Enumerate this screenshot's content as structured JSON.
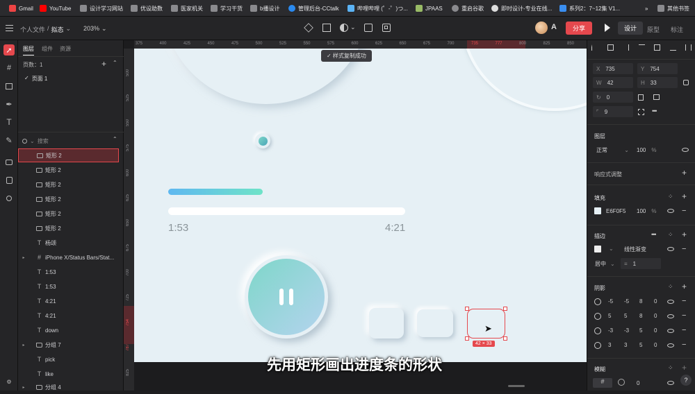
{
  "bookmarks": [
    {
      "label": "Gmail"
    },
    {
      "label": "YouTube"
    },
    {
      "label": "设计学习网站"
    },
    {
      "label": "优设助数"
    },
    {
      "label": "医家机关"
    },
    {
      "label": "学习干货"
    },
    {
      "label": "b播设计"
    },
    {
      "label": "管理后台-CCtalk"
    },
    {
      "label": "哔哩哔哩 (゜-゜)つ..."
    },
    {
      "label": "JPAAS"
    },
    {
      "label": "重启谷歌"
    },
    {
      "label": "即时设计-专业在线..."
    },
    {
      "label": "系列2：7~12集 V1..."
    },
    {
      "label": "»"
    },
    {
      "label": "其他书签"
    }
  ],
  "toolbar": {
    "breadcrumb_root": "个人文件",
    "breadcrumb_sep": "/",
    "breadcrumb_file": "拟态",
    "zoom": "203%",
    "share_label": "分享",
    "mode_tabs": [
      {
        "label": "设计"
      },
      {
        "label": "原型"
      },
      {
        "label": "标注"
      }
    ]
  },
  "layers_panel": {
    "tabs": [
      {
        "label": "图层"
      },
      {
        "label": "组件"
      },
      {
        "label": "资源"
      }
    ],
    "pages_label": "页数：1",
    "page_item": "页面 1",
    "search_placeholder": "搜索",
    "items": [
      {
        "label": "矩形 2",
        "kind": "rect",
        "selected": true
      },
      {
        "label": "矩形 2",
        "kind": "rect"
      },
      {
        "label": "矩形 2",
        "kind": "rect"
      },
      {
        "label": "矩形 2",
        "kind": "rect"
      },
      {
        "label": "矩形 2",
        "kind": "rect"
      },
      {
        "label": "矩形 2",
        "kind": "rect"
      },
      {
        "label": "杨颂",
        "kind": "text"
      },
      {
        "label": "iPhone X/Status Bars/Stat...",
        "kind": "frame"
      },
      {
        "label": "1:53",
        "kind": "text"
      },
      {
        "label": "1:53",
        "kind": "text"
      },
      {
        "label": "4:21",
        "kind": "text"
      },
      {
        "label": "4:21",
        "kind": "text"
      },
      {
        "label": "down",
        "kind": "text"
      },
      {
        "label": "分组 7",
        "kind": "group"
      },
      {
        "label": "pick",
        "kind": "text"
      },
      {
        "label": "like",
        "kind": "text"
      },
      {
        "label": "分组 4",
        "kind": "group"
      }
    ]
  },
  "ruler": {
    "h_ticks": [
      "375",
      "400",
      "425",
      "450",
      "475",
      "500",
      "525",
      "550",
      "575",
      "600",
      "625",
      "650",
      "675",
      "700",
      "735",
      "777",
      "800",
      "825",
      "850"
    ],
    "v_ticks": [
      "500",
      "525",
      "550",
      "575",
      "600",
      "625",
      "650",
      "675",
      "700",
      "725",
      "754",
      "787",
      "825"
    ]
  },
  "toast": "✓ 样式复制成功",
  "artboard": {
    "time_elapsed": "1:53",
    "time_total": "4:21",
    "progress": 0.4,
    "selection_size": "42 × 33"
  },
  "subtitle": "先用矩形画出进度条的形状",
  "inspector": {
    "x_label": "X",
    "x": "735",
    "y_label": "Y",
    "y": "754",
    "w_label": "W",
    "w": "42",
    "h_label": "H",
    "h": "33",
    "rotation": "0",
    "radius": "9",
    "layer_title": "图层",
    "blend_mode": "正常",
    "layer_opacity": "100",
    "percent": "%",
    "responsive": "响应式调整",
    "fill_title": "填充",
    "fill_color": "E6F0F5",
    "fill_opacity": "100",
    "stroke_title": "描边",
    "stroke_type": "线性渐变",
    "stroke_align": "居中",
    "stroke_width": "1",
    "shadow_title": "阴影",
    "shadows": [
      {
        "x": "-5",
        "y": "-5",
        "blur": "8",
        "spread": "0"
      },
      {
        "x": "5",
        "y": "5",
        "blur": "8",
        "spread": "0"
      },
      {
        "x": "-3",
        "y": "-3",
        "blur": "5",
        "spread": "0"
      },
      {
        "x": "3",
        "y": "3",
        "blur": "5",
        "spread": "0"
      }
    ],
    "blur_title": "模糊",
    "blur_value": "0"
  },
  "help": "?",
  "colors": {
    "accent": "#e5484d",
    "fill": "#e6f0f5",
    "progress_start": "#5fb8f0",
    "progress_end": "#6fe3c8",
    "button_start": "#7ed6c9",
    "button_end": "#b4d4ee"
  }
}
